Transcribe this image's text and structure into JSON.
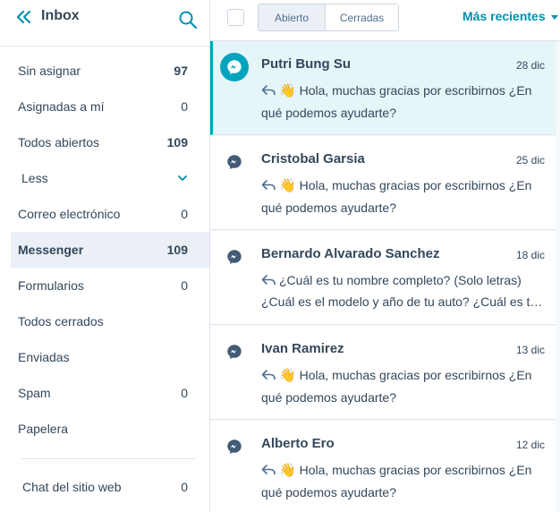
{
  "sidebar": {
    "title": "Inbox",
    "items": [
      {
        "label": "Sin asignar",
        "count": "97",
        "bold": true
      },
      {
        "label": "Asignadas a mí",
        "count": "0"
      },
      {
        "label": "Todos abiertos",
        "count": "109",
        "bold": true
      },
      {
        "label": "Less",
        "count": ""
      },
      {
        "label": "Correo electrónico",
        "count": "0"
      },
      {
        "label": "Messenger",
        "count": "109",
        "active": true
      },
      {
        "label": "Formularios",
        "count": "0"
      },
      {
        "label": "Todos cerrados",
        "count": ""
      },
      {
        "label": "Enviadas",
        "count": ""
      },
      {
        "label": "Spam",
        "count": "0"
      },
      {
        "label": "Papelera",
        "count": ""
      }
    ],
    "chat": {
      "label": "Chat del sitio web",
      "count": "0"
    }
  },
  "toolbar": {
    "filter_open": "Abierto",
    "filter_closed": "Cerradas",
    "sort_label": "Más recientes"
  },
  "conversations": [
    {
      "name": "Putri Bung Su",
      "date": "28 dic",
      "line1": "Hola, muchas gracias por escribirnos ¿En",
      "line2": "qué podemos ayudarte?",
      "emoji": "👋"
    },
    {
      "name": "Cristobal Garsia",
      "date": "25 dic",
      "line1": "Hola, muchas gracias por escribirnos ¿En",
      "line2": "qué podemos ayudarte?",
      "emoji": "👋"
    },
    {
      "name": "Bernardo Alvarado Sanchez",
      "date": "18 dic",
      "line1": "¿Cuál es tu nombre completo? (Solo letras)",
      "line2": "¿Cuál es el modelo y año de tu auto? ¿Cuál es t…",
      "emoji": ""
    },
    {
      "name": "Ivan Ramirez",
      "date": "13 dic",
      "line1": "Hola, muchas gracias por escribirnos ¿En",
      "line2": "qué podemos ayudarte?",
      "emoji": "👋"
    },
    {
      "name": "Alberto Ero",
      "date": "12 dic",
      "line1": "Hola, muchas gracias por escribirnos ¿En",
      "line2": "qué podemos ayudarte?",
      "emoji": "👋"
    }
  ],
  "colors": {
    "accent": "#00a4bd",
    "link": "#0091ae",
    "text": "#33475b",
    "selected_bg": "#e5f5f8"
  }
}
